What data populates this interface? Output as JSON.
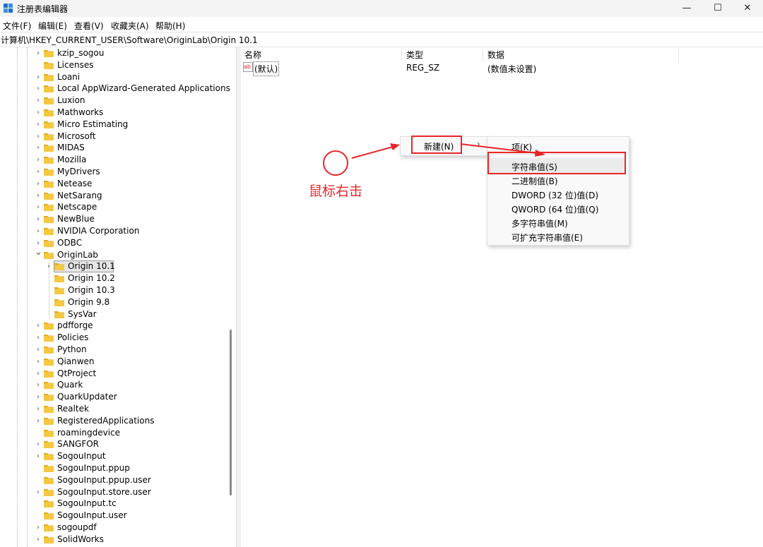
{
  "window": {
    "title": "注册表编辑器",
    "controls": {
      "minimize": "—",
      "maximize": "☐",
      "close": "✕"
    }
  },
  "menu": [
    "文件(F)",
    "编辑(E)",
    "查看(V)",
    "收藏夹(A)",
    "帮助(H)"
  ],
  "address": "计算机\\HKEY_CURRENT_USER\\Software\\OriginLab\\Origin 10.1",
  "tree": {
    "items": [
      {
        "label": "kzip_sogou",
        "expander": "collapsed",
        "depth": 0
      },
      {
        "label": "Licenses",
        "expander": "none",
        "depth": 0
      },
      {
        "label": "Loani",
        "expander": "collapsed",
        "depth": 0
      },
      {
        "label": "Local AppWizard-Generated Applications",
        "expander": "collapsed",
        "depth": 0
      },
      {
        "label": "Luxion",
        "expander": "collapsed",
        "depth": 0
      },
      {
        "label": "Mathworks",
        "expander": "collapsed",
        "depth": 0
      },
      {
        "label": "Micro Estimating",
        "expander": "collapsed",
        "depth": 0
      },
      {
        "label": "Microsoft",
        "expander": "collapsed",
        "depth": 0
      },
      {
        "label": "MIDAS",
        "expander": "collapsed",
        "depth": 0
      },
      {
        "label": "Mozilla",
        "expander": "collapsed",
        "depth": 0
      },
      {
        "label": "MyDrivers",
        "expander": "collapsed",
        "depth": 0
      },
      {
        "label": "Netease",
        "expander": "collapsed",
        "depth": 0
      },
      {
        "label": "NetSarang",
        "expander": "collapsed",
        "depth": 0
      },
      {
        "label": "Netscape",
        "expander": "collapsed",
        "depth": 0
      },
      {
        "label": "NewBlue",
        "expander": "collapsed",
        "depth": 0
      },
      {
        "label": "NVIDIA Corporation",
        "expander": "collapsed",
        "depth": 0
      },
      {
        "label": "ODBC",
        "expander": "collapsed",
        "depth": 0
      },
      {
        "label": "OriginLab",
        "expander": "expanded",
        "depth": 0
      },
      {
        "label": "Origin 10.1",
        "expander": "collapsed",
        "depth": 1,
        "selected": true
      },
      {
        "label": "Origin 10.2",
        "expander": "none",
        "depth": 1
      },
      {
        "label": "Origin 10.3",
        "expander": "none",
        "depth": 1
      },
      {
        "label": "Origin 9.8",
        "expander": "none",
        "depth": 1
      },
      {
        "label": "SysVar",
        "expander": "none",
        "depth": 1
      },
      {
        "label": "pdfforge",
        "expander": "collapsed",
        "depth": 0
      },
      {
        "label": "Policies",
        "expander": "collapsed",
        "depth": 0
      },
      {
        "label": "Python",
        "expander": "collapsed",
        "depth": 0
      },
      {
        "label": "Qianwen",
        "expander": "collapsed",
        "depth": 0
      },
      {
        "label": "QtProject",
        "expander": "collapsed",
        "depth": 0
      },
      {
        "label": "Quark",
        "expander": "collapsed",
        "depth": 0
      },
      {
        "label": "QuarkUpdater",
        "expander": "collapsed",
        "depth": 0
      },
      {
        "label": "Realtek",
        "expander": "collapsed",
        "depth": 0
      },
      {
        "label": "RegisteredApplications",
        "expander": "collapsed",
        "depth": 0
      },
      {
        "label": "roamingdevice",
        "expander": "none",
        "depth": 0
      },
      {
        "label": "SANGFOR",
        "expander": "collapsed",
        "depth": 0
      },
      {
        "label": "SogouInput",
        "expander": "collapsed",
        "depth": 0
      },
      {
        "label": "SogouInput.ppup",
        "expander": "none",
        "depth": 0
      },
      {
        "label": "SogouInput.ppup.user",
        "expander": "none",
        "depth": 0
      },
      {
        "label": "SogouInput.store.user",
        "expander": "collapsed",
        "depth": 0
      },
      {
        "label": "SogouInput.tc",
        "expander": "none",
        "depth": 0
      },
      {
        "label": "SogouInput.user",
        "expander": "none",
        "depth": 0
      },
      {
        "label": "sogoupdf",
        "expander": "collapsed",
        "depth": 0
      },
      {
        "label": "SolidWorks",
        "expander": "collapsed",
        "depth": 0
      }
    ]
  },
  "list": {
    "columns": [
      "名称",
      "类型",
      "数据"
    ],
    "rows": [
      {
        "icon": "ab",
        "name": "(默认)",
        "type": "REG_SZ",
        "data": "(数值未设置)"
      }
    ]
  },
  "context_menu": {
    "new_label": "新建(N)",
    "submenu": [
      "项(K)",
      "字符串值(S)",
      "二进制值(B)",
      "DWORD (32 位)值(D)",
      "QWORD (64 位)值(Q)",
      "多字符串值(M)",
      "可扩充字符串值(E)"
    ],
    "highlighted_index": 1
  },
  "annotation": {
    "text": "鼠标右击",
    "color": "#e8262a"
  },
  "colors": {
    "folder": "#f5c842",
    "folder_dark": "#e0a91f",
    "highlight": "#e8262a",
    "selection": "#e5e5e5"
  }
}
